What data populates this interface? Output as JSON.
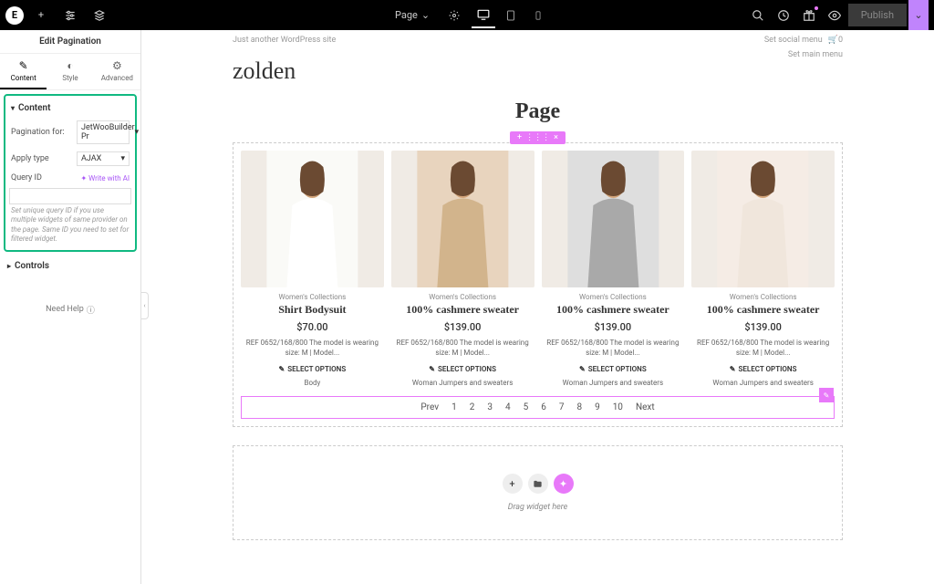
{
  "topbar": {
    "page_label": "Page",
    "publish_label": "Publish"
  },
  "sidebar": {
    "title": "Edit Pagination",
    "tabs": [
      {
        "label": "Content"
      },
      {
        "label": "Style"
      },
      {
        "label": "Advanced"
      }
    ],
    "content_section": {
      "title": "Content",
      "pagination_for": {
        "label": "Pagination for:",
        "value": "JetWooBuilder Pr"
      },
      "apply_type": {
        "label": "Apply type",
        "value": "AJAX"
      },
      "query_id": {
        "label": "Query ID",
        "ai_link": "✦ Write with AI"
      },
      "help_text": "Set unique query ID if you use multiple widgets of same provider on the page. Same ID you need to set for filtered widget."
    },
    "controls_title": "Controls",
    "need_help": "Need Help"
  },
  "canvas": {
    "tagline": "Just another WordPress site",
    "social_menu": "Set social menu",
    "cart_count": "0",
    "site_title": "zolden",
    "main_menu": "Set main menu",
    "page_title": "Page"
  },
  "products": [
    {
      "collection": "Women's Collections",
      "title": "Shirt Bodysuit",
      "price": "$70.00",
      "desc": "REF 0652/168/800 The model is wearing size: M | Model...",
      "select": "SELECT OPTIONS",
      "category": "Body"
    },
    {
      "collection": "Women's Collections",
      "title": "100% cashmere sweater",
      "price": "$139.00",
      "desc": "REF 0652/168/800 The model is wearing size: M | Model...",
      "select": "SELECT OPTIONS",
      "category": "Woman Jumpers and sweaters"
    },
    {
      "collection": "Women's Collections",
      "title": "100% cashmere sweater",
      "price": "$139.00",
      "desc": "REF 0652/168/800 The model is wearing size: M | Model...",
      "select": "SELECT OPTIONS",
      "category": "Woman Jumpers and sweaters"
    },
    {
      "collection": "Women's Collections",
      "title": "100% cashmere sweater",
      "price": "$139.00",
      "desc": "REF 0652/168/800 The model is wearing size: M | Model...",
      "select": "SELECT OPTIONS",
      "category": "Woman Jumpers and sweaters"
    }
  ],
  "pagination": {
    "prev": "Prev",
    "p1": "1",
    "p2": "2",
    "p3": "3",
    "p4": "4",
    "p5": "5",
    "p6": "6",
    "p7": "7",
    "p8": "8",
    "p9": "9",
    "p10": "10",
    "next": "Next"
  },
  "dropzone_text": "Drag widget here",
  "colors": {
    "accent": "#e879f9",
    "highlight": "#10b981"
  }
}
